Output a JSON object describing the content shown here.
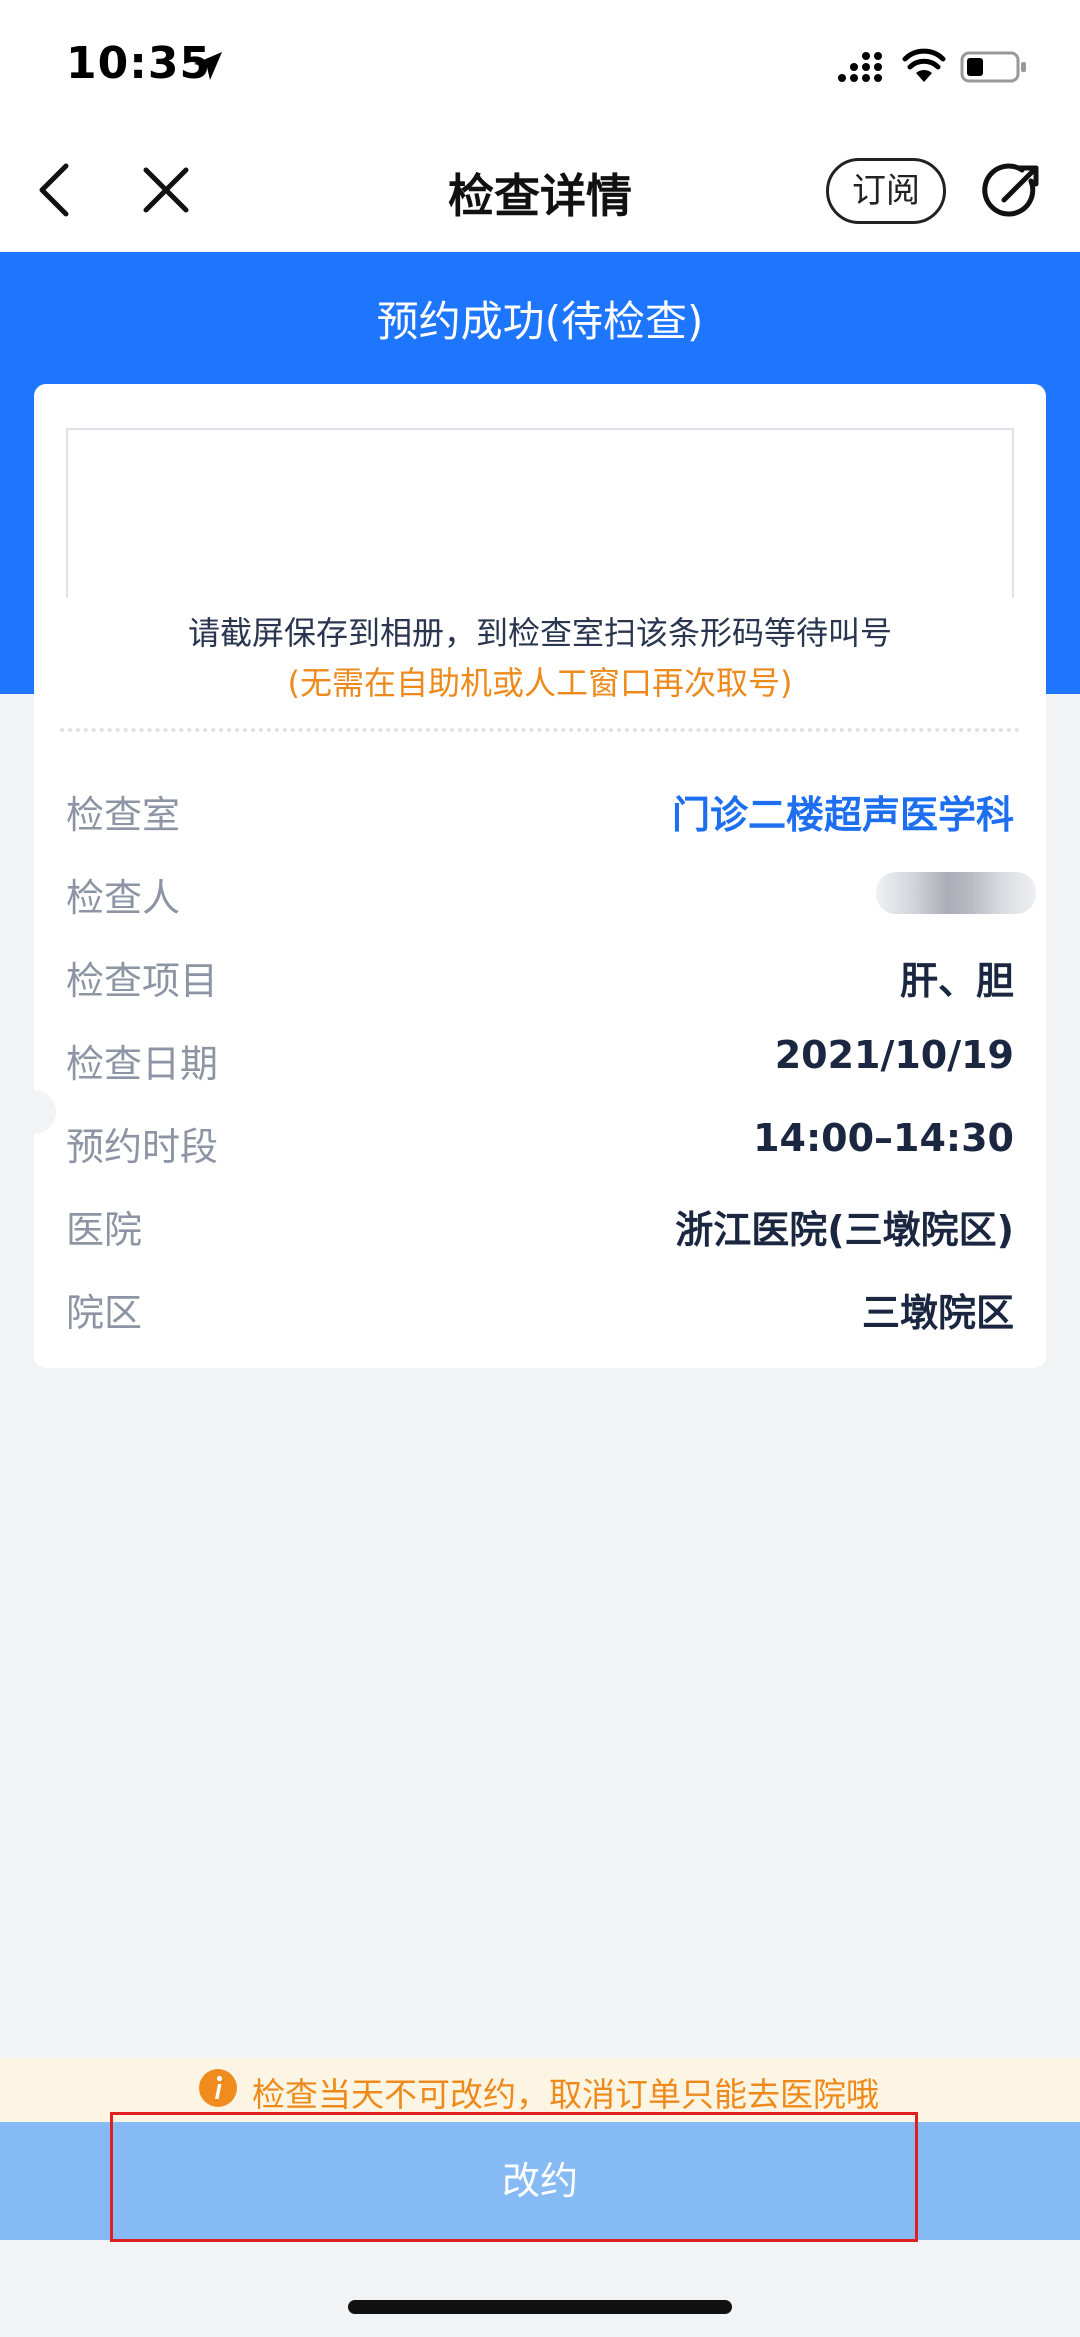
{
  "status_bar": {
    "time": "10:35"
  },
  "nav": {
    "title": "检查详情",
    "subscribe_label": "订阅"
  },
  "status": {
    "heading": "预约成功(待检查)"
  },
  "ticket": {
    "tip_line1": "请截屏保存到相册，到检查室扫该条形码等待叫号",
    "tip_line2": "(无需在自助机或人工窗口再次取号)"
  },
  "details": {
    "rows": [
      {
        "label": "检查室",
        "value": "门诊二楼超声医学科"
      },
      {
        "label": "检查人",
        "value": ""
      },
      {
        "label": "检查项目",
        "value": "肝、胆"
      },
      {
        "label": "检查日期",
        "value": "2021/10/19"
      },
      {
        "label": "预约时段",
        "value": "14:00–14:30"
      },
      {
        "label": "医院",
        "value": "浙江医院(三墩院区)"
      },
      {
        "label": "院区",
        "value": "三墩院区"
      }
    ]
  },
  "warning": {
    "text": "检查当天不可改约，取消订单只能去医院哦"
  },
  "action": {
    "label": "改约"
  },
  "colors": {
    "primary": "#1e76ff",
    "warning": "#ee8a1c",
    "button_disabled": "#86baf4",
    "highlight": "#e02020"
  }
}
